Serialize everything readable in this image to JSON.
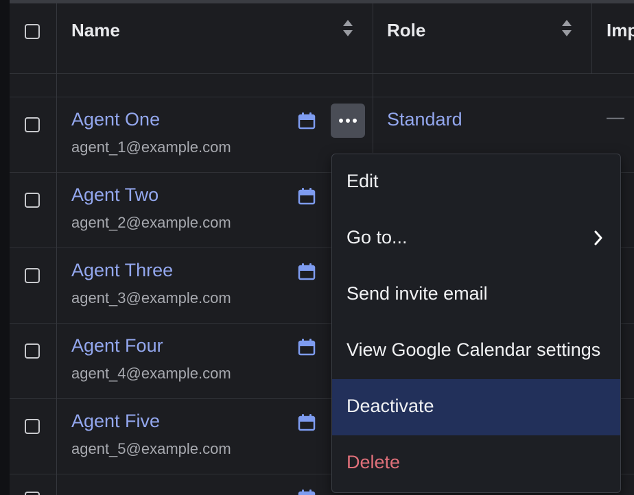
{
  "table": {
    "columns": {
      "name": "Name",
      "role": "Role",
      "imp": "Imp"
    },
    "rows": [
      {
        "name": "Agent One",
        "email": "agent_1@example.com",
        "role": "Standard",
        "imp": "—"
      },
      {
        "name": "Agent Two",
        "email": "agent_2@example.com"
      },
      {
        "name": "Agent Three",
        "email": "agent_3@example.com"
      },
      {
        "name": "Agent Four",
        "email": "agent_4@example.com"
      },
      {
        "name": "Agent Five",
        "email": "agent_5@example.com"
      }
    ]
  },
  "menu": {
    "items": [
      {
        "label": "Edit"
      },
      {
        "label": "Go to..."
      },
      {
        "label": "Send invite email"
      },
      {
        "label": "View Google Calendar settings"
      },
      {
        "label": "Deactivate"
      },
      {
        "label": "Delete"
      }
    ]
  },
  "colors": {
    "link": "#93a7ee",
    "selected_bg": "#22305a",
    "danger": "#e0707a",
    "calendar_icon": "#7e9cf0"
  }
}
